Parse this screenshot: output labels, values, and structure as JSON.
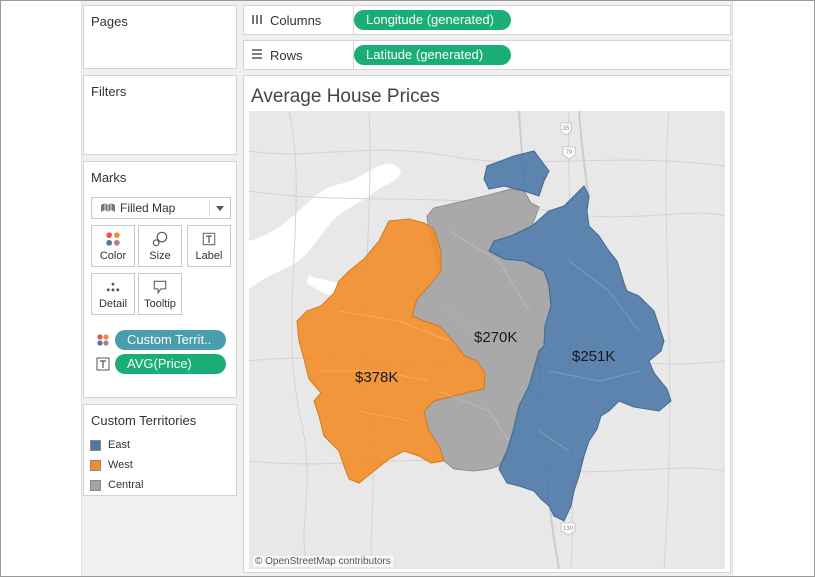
{
  "pages": {
    "title": "Pages"
  },
  "filters": {
    "title": "Filters"
  },
  "columns": {
    "label": "Columns",
    "pill": "Longitude (generated)"
  },
  "rows": {
    "label": "Rows",
    "pill": "Latitude (generated)"
  },
  "marks": {
    "title": "Marks",
    "mark_type": "Filled Map",
    "buttons": [
      {
        "label": "Color",
        "icon": "color-dots-icon"
      },
      {
        "label": "Size",
        "icon": "size-circles-icon"
      },
      {
        "label": "Label",
        "icon": "label-text-icon"
      },
      {
        "label": "Detail",
        "icon": "detail-dots-icon"
      },
      {
        "label": "Tooltip",
        "icon": "tooltip-bubble-icon"
      }
    ],
    "fields": [
      {
        "label": "Custom Territ..",
        "icon": "color-dots-icon",
        "color": "#4a9dab"
      },
      {
        "label": "AVG(Price)",
        "icon": "label-text-icon",
        "color": "#1aae76"
      }
    ]
  },
  "legend": {
    "title": "Custom Territories",
    "items": [
      {
        "label": "East",
        "color": "#4e79a7"
      },
      {
        "label": "West",
        "color": "#f28e2b"
      },
      {
        "label": "Central",
        "color": "#a5a5a5"
      }
    ]
  },
  "view": {
    "title": "Average House Prices",
    "regions": [
      {
        "name": "West",
        "value_label": "$378K",
        "color": "#f28e2b"
      },
      {
        "name": "Central",
        "value_label": "$270K",
        "color": "#a5a5a5"
      },
      {
        "name": "East",
        "value_label": "$251K",
        "color": "#4e79a7"
      }
    ],
    "road_shields": [
      "35",
      "79",
      "130"
    ],
    "attribution": "© OpenStreetMap contributors"
  }
}
